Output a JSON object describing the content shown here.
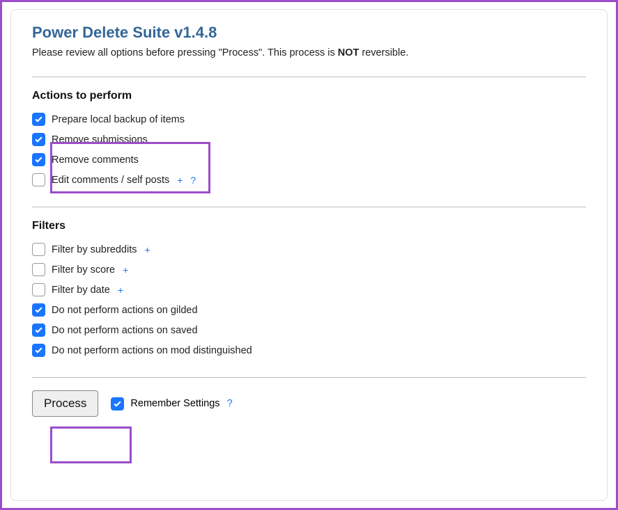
{
  "title": "Power Delete Suite v1.4.8",
  "subtitle_pre": "Please review all options before pressing \"Process\". This process is ",
  "subtitle_bold": "NOT",
  "subtitle_post": " reversible.",
  "actions": {
    "heading": "Actions to perform",
    "items": [
      {
        "label": "Prepare local backup of items",
        "checked": true,
        "expand": false,
        "help": false
      },
      {
        "label": "Remove submissions",
        "checked": true,
        "expand": false,
        "help": false
      },
      {
        "label": "Remove comments",
        "checked": true,
        "expand": false,
        "help": false
      },
      {
        "label": "Edit comments / self posts",
        "checked": false,
        "expand": true,
        "help": true
      }
    ]
  },
  "filters": {
    "heading": "Filters",
    "items": [
      {
        "label": "Filter by subreddits",
        "checked": false,
        "expand": true
      },
      {
        "label": "Filter by score",
        "checked": false,
        "expand": true
      },
      {
        "label": "Filter by date",
        "checked": false,
        "expand": true
      },
      {
        "label": "Do not perform actions on gilded",
        "checked": true,
        "expand": false
      },
      {
        "label": "Do not perform actions on saved",
        "checked": true,
        "expand": false
      },
      {
        "label": "Do not perform actions on mod distinguished",
        "checked": true,
        "expand": false
      }
    ]
  },
  "process_button": "Process",
  "remember": {
    "label": "Remember Settings",
    "checked": true,
    "help": "?"
  },
  "expand_glyph": "+",
  "help_glyph": "?"
}
